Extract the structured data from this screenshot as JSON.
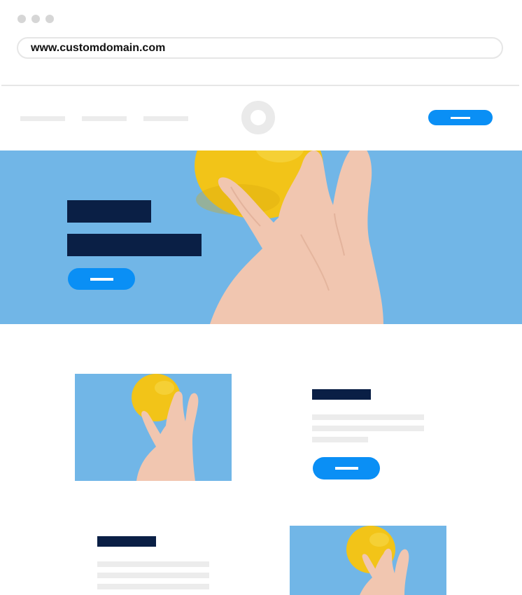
{
  "browser": {
    "url": "www.customdomain.com",
    "dot_color": "#d6d6d6",
    "urlbar_border": "#e6e6e6"
  },
  "colors": {
    "sky_blue": "#71b6e7",
    "navy": "#0a1f45",
    "accent_blue": "#0a8ff5",
    "placeholder_gray": "#ececec",
    "lemon_yellow": "#f2c418",
    "skin": "#f1c6b0"
  },
  "header": {
    "nav_items": [
      "nav-placeholder-1",
      "nav-placeholder-2",
      "nav-placeholder-3"
    ],
    "logo_icon": "ring-logo-icon",
    "cta": "button-placeholder"
  },
  "hero": {
    "image": "hand-holding-lemon",
    "title_lines": 2,
    "cta": "button-placeholder"
  },
  "rows": [
    {
      "image": "hand-holding-lemon",
      "image_side": "left",
      "text_lines": 3,
      "has_button": true
    },
    {
      "image": "hand-holding-lemon",
      "image_side": "right",
      "text_lines": 3,
      "has_button": false
    }
  ]
}
